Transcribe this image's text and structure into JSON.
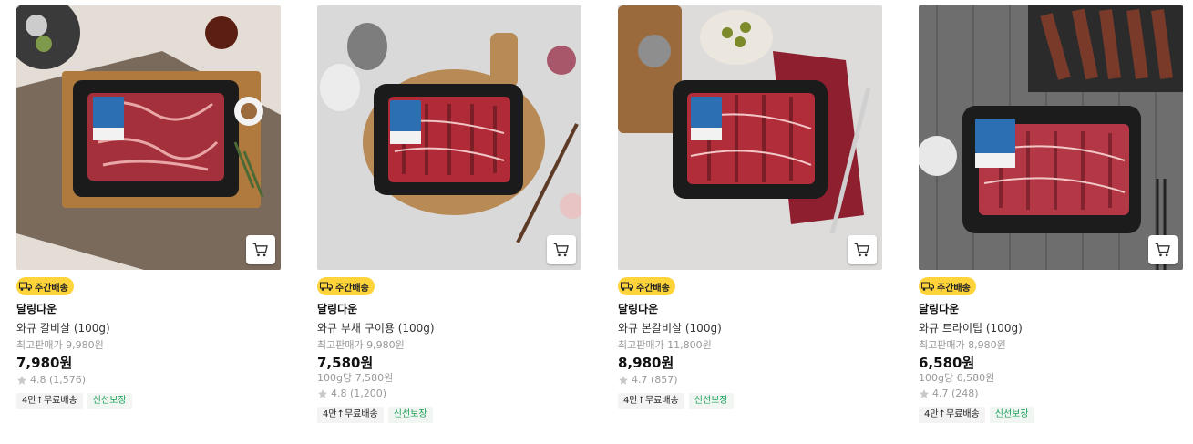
{
  "colors": {
    "badge_bg": "#ffd43b",
    "fresh_tag_text": "#18a058",
    "star": "#c8c8c8"
  },
  "products": [
    {
      "badge": "주간배송",
      "brand": "달링다운",
      "name": "와규 갈비살 (100g)",
      "orig_price": "최고판매가 9,980원",
      "price": "7,980원",
      "unit_price": "",
      "rating": "4.8 (1,576)",
      "tags": [
        "4만↑무료배송",
        "신선보장"
      ],
      "icons": [
        "truck-icon",
        "cart-icon",
        "star-icon"
      ]
    },
    {
      "badge": "주간배송",
      "brand": "달링다운",
      "name": "와규 부채 구이용 (100g)",
      "orig_price": "최고판매가 9,980원",
      "price": "7,580원",
      "unit_price": "100g당 7,580원",
      "rating": "4.8 (1,200)",
      "tags": [
        "4만↑무료배송",
        "신선보장"
      ],
      "icons": [
        "truck-icon",
        "cart-icon",
        "star-icon"
      ]
    },
    {
      "badge": "주간배송",
      "brand": "달링다운",
      "name": "와규 본갈비살 (100g)",
      "orig_price": "최고판매가 11,800원",
      "price": "8,980원",
      "unit_price": "",
      "rating": "4.7 (857)",
      "tags": [
        "4만↑무료배송",
        "신선보장"
      ],
      "icons": [
        "truck-icon",
        "cart-icon",
        "star-icon"
      ]
    },
    {
      "badge": "주간배송",
      "brand": "달링다운",
      "name": "와규 트라이팁 (100g)",
      "orig_price": "최고판매가 8,980원",
      "price": "6,580원",
      "unit_price": "100g당 6,580원",
      "rating": "4.7 (248)",
      "tags": [
        "4만↑무료배송",
        "신선보장"
      ],
      "icons": [
        "truck-icon",
        "cart-icon",
        "star-icon"
      ]
    }
  ]
}
